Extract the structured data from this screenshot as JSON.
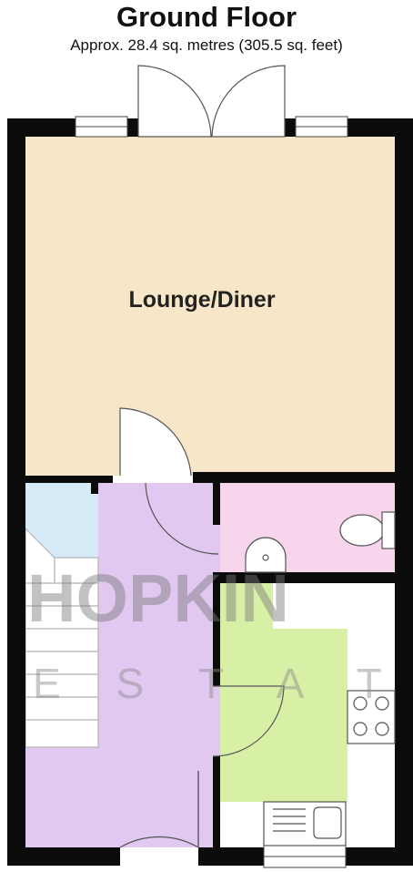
{
  "header": {
    "title": "Ground Floor",
    "subtitle": "Approx. 28.4 sq. metres (305.5 sq. feet)"
  },
  "rooms": {
    "lounge": {
      "label": "Lounge/Diner",
      "color": "#f7e6c7"
    },
    "hall": {
      "color": "#e0c8f0"
    },
    "understairs": {
      "color": "#d6ebf7"
    },
    "wc": {
      "color": "#f7d5ec"
    },
    "kitchen": {
      "color": "#d8f0a6"
    }
  },
  "watermark": {
    "main": "HOPKIN",
    "sub": "E S T A T"
  },
  "colors": {
    "wall": "#0b0b0b",
    "window": "#ffffff"
  }
}
